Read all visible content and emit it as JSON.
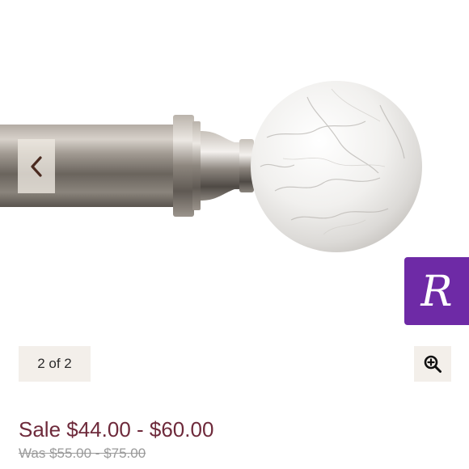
{
  "gallery": {
    "image_alt": "Curtain rod with white marble ball finial",
    "counter_text": "2 of 2",
    "prev_icon": "chevron-left-icon",
    "zoom_icon": "zoom-in-icon"
  },
  "badge": {
    "letter": "R",
    "color": "#6e2aa6"
  },
  "pricing": {
    "sale_text": "Sale $44.00 - $60.00",
    "was_text": "Was $55.00 - $75.00",
    "sale_color": "#6e2a3b"
  }
}
